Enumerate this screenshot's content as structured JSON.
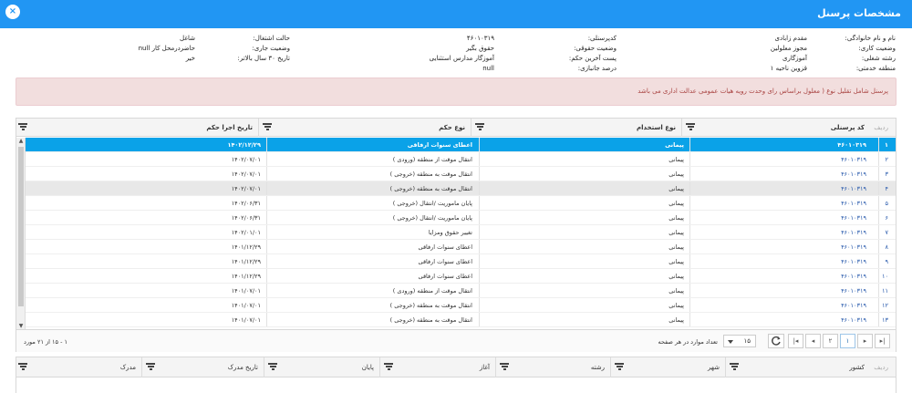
{
  "window": {
    "title": "مشخصات پرسنل",
    "close_label": "×"
  },
  "info": {
    "col1": [
      {
        "label": "نام و نام خانوادگی:",
        "value": "مقدم زابادی"
      },
      {
        "label": "وضعیت کاری:",
        "value": "مجوز معلولین"
      },
      {
        "label": "رشته شغلی:",
        "value": "آموزگاری"
      },
      {
        "label": "منطقه خدمتی:",
        "value": "قزوین ناحیه ۱"
      }
    ],
    "col2": [
      {
        "label": "کدپرسنلی:",
        "value": "۴۶۰۱۰۳۱۹"
      },
      {
        "label": "وضعیت حقوقی:",
        "value": "حقوق بگیر"
      },
      {
        "label": "پست آخرین حکم:",
        "value": "آموزگار مدارس استثنایی"
      },
      {
        "label": "درصد جانبازی:",
        "value": "null"
      }
    ],
    "col3": [
      {
        "label": "حالت اشتغال:",
        "value": "شاغل"
      },
      {
        "label": "وضعیت جاری:",
        "value": "حاضردرمحل کار null"
      },
      {
        "label": "تاریخ ۳۰ سال بالاتر:",
        "value": "خیر"
      }
    ]
  },
  "warning": "پرسنل شامل تقلیل نوع ( معلول براساس رای وحدت رویه هیات عمومی عدالت اداری می باشد",
  "grid": {
    "rownum_header": "ردیف",
    "columns": [
      "کد پرسنلی",
      "نوع استخدام",
      "نوع حکم",
      "تاریخ اجرا حکم"
    ],
    "rows": [
      {
        "n": "۱",
        "code": "۴۶۰۱۰۳۱۹",
        "type": "پیمانی",
        "order": "اعطای سنوات ارفاقی",
        "date": "۱۴۰۲/۱۲/۲۹"
      },
      {
        "n": "۲",
        "code": "۴۶۰۱۰۳۱۹",
        "type": "پیمانی",
        "order": "انتقال موقت از منطقه (ورودی )",
        "date": "۱۴۰۲/۰۷/۰۱"
      },
      {
        "n": "۳",
        "code": "۴۶۰۱۰۳۱۹",
        "type": "پیمانی",
        "order": "انتقال موقت به منطقه (خروجی )",
        "date": "۱۴۰۲/۰۷/۰۱"
      },
      {
        "n": "۴",
        "code": "۴۶۰۱۰۳۱۹",
        "type": "پیمانی",
        "order": "انتقال موقت به منطقه (خروجی )",
        "date": "۱۴۰۲/۰۷/۰۱"
      },
      {
        "n": "۵",
        "code": "۴۶۰۱۰۳۱۹",
        "type": "پیمانی",
        "order": "پایان ماموریت /انتقال (خروجی )",
        "date": "۱۴۰۲/۰۶/۳۱"
      },
      {
        "n": "۶",
        "code": "۴۶۰۱۰۳۱۹",
        "type": "پیمانی",
        "order": "پایان ماموریت /انتقال (خروجی )",
        "date": "۱۴۰۲/۰۶/۳۱"
      },
      {
        "n": "۷",
        "code": "۴۶۰۱۰۳۱۹",
        "type": "پیمانی",
        "order": "تغییر حقوق ومزایا",
        "date": "۱۴۰۲/۰۱/۰۱"
      },
      {
        "n": "۸",
        "code": "۴۶۰۱۰۳۱۹",
        "type": "پیمانی",
        "order": "اعطای سنوات ارفاقی",
        "date": "۱۴۰۱/۱۲/۲۹"
      },
      {
        "n": "۹",
        "code": "۴۶۰۱۰۳۱۹",
        "type": "پیمانی",
        "order": "اعطای سنوات ارفاقی",
        "date": "۱۴۰۱/۱۲/۲۹"
      },
      {
        "n": "۱۰",
        "code": "۴۶۰۱۰۳۱۹",
        "type": "پیمانی",
        "order": "اعطای سنوات ارفاقی",
        "date": "۱۴۰۱/۱۲/۲۹"
      },
      {
        "n": "۱۱",
        "code": "۴۶۰۱۰۳۱۹",
        "type": "پیمانی",
        "order": "انتقال موقت از منطقه (ورودی )",
        "date": "۱۴۰۱/۰۷/۰۱"
      },
      {
        "n": "۱۲",
        "code": "۴۶۰۱۰۳۱۹",
        "type": "پیمانی",
        "order": "انتقال موقت به منطقه (خروجی )",
        "date": "۱۴۰۱/۰۷/۰۱"
      },
      {
        "n": "۱۳",
        "code": "۴۶۰۱۰۳۱۹",
        "type": "پیمانی",
        "order": "انتقال موقت به منطقه (خروجی )",
        "date": "۱۴۰۱/۰۷/۰۱"
      }
    ],
    "selected_row": 0,
    "highlighted_row": 3
  },
  "pager": {
    "current_page": "۱",
    "next_page": "۲",
    "page_size": "۱۵",
    "page_size_label": "تعداد موارد در هر صفحه",
    "range_text": "۱ - ۱۵ از ۲۱ مورد"
  },
  "grid2": {
    "rownum_header": "ردیف",
    "columns": [
      "کشور",
      "شهر",
      "رشته",
      "آغاز",
      "پایان",
      "تاریخ مدرک",
      "مدرک"
    ]
  },
  "colors": {
    "accent": "#2196f3",
    "selected_row": "#0aa2e8",
    "warning_bg": "#f2dede",
    "warning_text": "#a94442"
  }
}
